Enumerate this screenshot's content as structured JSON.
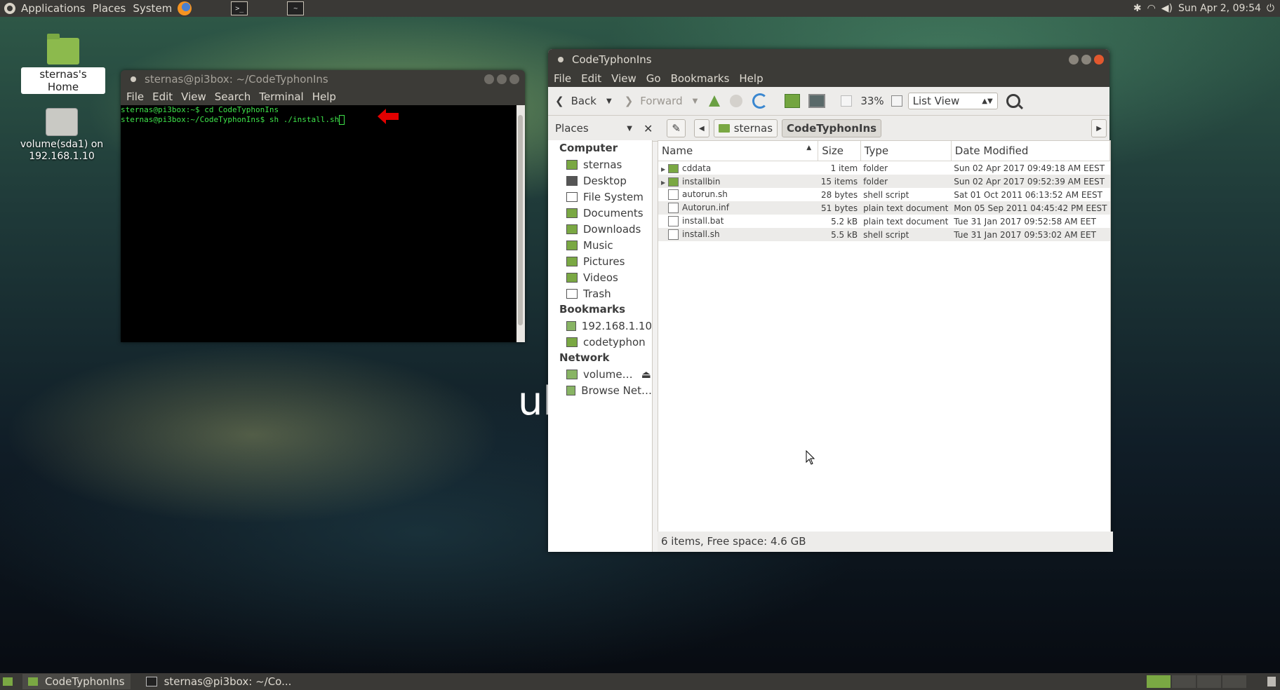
{
  "top_panel": {
    "menus": [
      "Applications",
      "Places",
      "System"
    ],
    "clock": "Sun Apr 2, 09:54"
  },
  "desktop": {
    "icons": [
      {
        "label": "sternas's Home"
      },
      {
        "label": "volume(sda1) on 192.168.1.10"
      }
    ],
    "wallpaper_text": "ub"
  },
  "terminal": {
    "title": "sternas@pi3box: ~/CodeTyphonIns",
    "menu": [
      "File",
      "Edit",
      "View",
      "Search",
      "Terminal",
      "Help"
    ],
    "lines": [
      "sternas@pi3box:~$ cd CodeTyphonIns",
      "sternas@pi3box:~/CodeTyphonIns$ sh ./install.sh"
    ],
    "text_color": "#3ee24a"
  },
  "file_manager": {
    "title": "CodeTyphonIns",
    "menu": [
      "File",
      "Edit",
      "View",
      "Go",
      "Bookmarks",
      "Help"
    ],
    "toolbar": {
      "back": "Back",
      "forward": "Forward",
      "zoom": "33%",
      "view_mode": "List View"
    },
    "location": {
      "pane": "Places",
      "crumbs": [
        "sternas",
        "CodeTyphonIns"
      ]
    },
    "sidebar": {
      "computer_header": "Computer",
      "computer": [
        "sternas",
        "Desktop",
        "File System",
        "Documents",
        "Downloads",
        "Music",
        "Pictures",
        "Videos",
        "Trash"
      ],
      "bookmarks_header": "Bookmarks",
      "bookmarks": [
        "192.168.1.10",
        "codetyphon"
      ],
      "network_header": "Network",
      "network": [
        "volume…",
        "Browse Net…"
      ]
    },
    "columns": [
      "Name",
      "Size",
      "Type",
      "Date Modified"
    ],
    "files": [
      {
        "name": "cddata",
        "size": "1 item",
        "type": "folder",
        "date": "Sun 02 Apr 2017 09:49:18 AM EEST",
        "kind": "folder"
      },
      {
        "name": "installbin",
        "size": "15 items",
        "type": "folder",
        "date": "Sun 02 Apr 2017 09:52:39 AM EEST",
        "kind": "folder"
      },
      {
        "name": "autorun.sh",
        "size": "28 bytes",
        "type": "shell script",
        "date": "Sat 01 Oct 2011 06:13:52 AM EEST",
        "kind": "file"
      },
      {
        "name": "Autorun.inf",
        "size": "51 bytes",
        "type": "plain text document",
        "date": "Mon 05 Sep 2011 04:45:42 PM EEST",
        "kind": "file"
      },
      {
        "name": "install.bat",
        "size": "5.2 kB",
        "type": "plain text document",
        "date": "Tue 31 Jan 2017 09:52:58 AM EET",
        "kind": "file"
      },
      {
        "name": "install.sh",
        "size": "5.5 kB",
        "type": "shell script",
        "date": "Tue 31 Jan 2017 09:53:02 AM EET",
        "kind": "file"
      }
    ],
    "status": "6 items, Free space: 4.6 GB"
  },
  "bottom_panel": {
    "tasks": [
      "CodeTyphonIns",
      "sternas@pi3box: ~/Co..."
    ]
  }
}
